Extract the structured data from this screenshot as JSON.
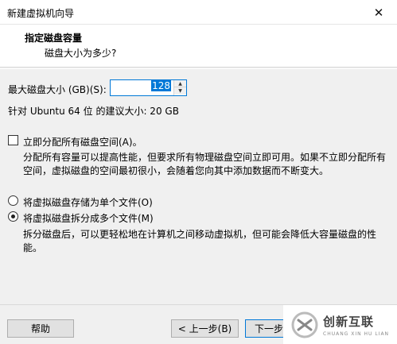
{
  "window": {
    "title": "新建虚拟机向导",
    "close_glyph": "✕"
  },
  "header": {
    "title": "指定磁盘容量",
    "subtitle": "磁盘大小为多少?"
  },
  "disk": {
    "max_size_label": "最大磁盘大小 (GB)(S):",
    "max_size_value": "128",
    "recommended": "针对 Ubuntu 64 位 的建议大小: 20 GB"
  },
  "allocate": {
    "label": "立即分配所有磁盘空间(A)。",
    "checked": false,
    "desc_line1": "分配所有容量可以提高性能，但要求所有物理磁盘空间立即可用。如果不立即分配所有",
    "desc_line2": "空间，虚拟磁盘的空间最初很小，会随着您向其中添加数据而不断变大。"
  },
  "storage": {
    "single_label": "将虚拟磁盘存储为单个文件(O)",
    "multi_label": "将虚拟磁盘拆分成多个文件(M)",
    "selected": "multi",
    "multi_desc_line1": "拆分磁盘后，可以更轻松地在计算机之间移动虚拟机，但可能会降低大容量磁盘的性",
    "multi_desc_line2": "能。"
  },
  "buttons": {
    "help": "帮助",
    "back": "< 上一步(B)",
    "next": "下一步"
  },
  "watermark": {
    "cn": "创新互联",
    "en": "CHUANG XIN HU LIAN"
  },
  "colors": {
    "accent": "#0078d7",
    "background": "#f0f0f0",
    "header_bg": "#ffffff"
  }
}
